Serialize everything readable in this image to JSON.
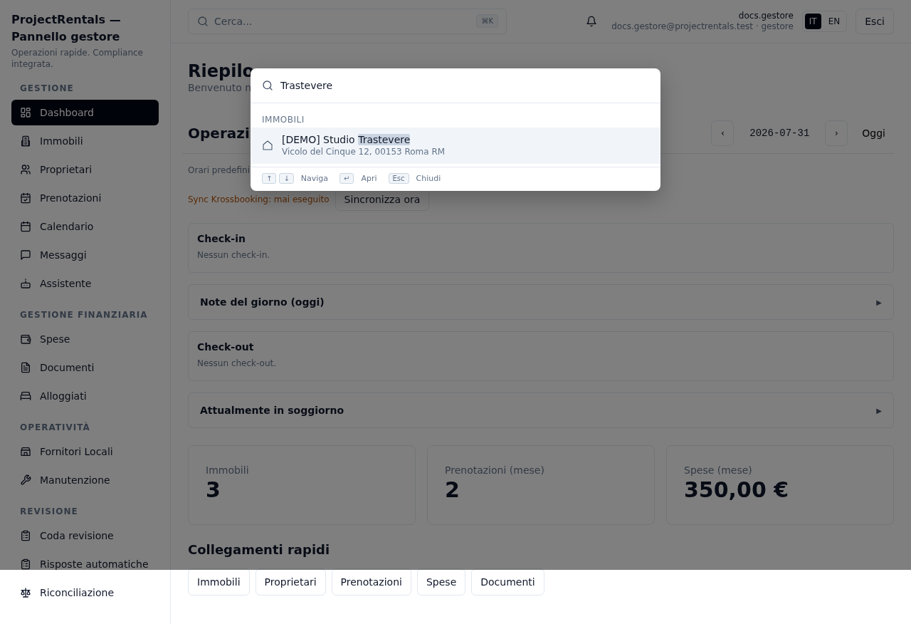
{
  "sidebar": {
    "title": "ProjectRentals — Pannello gestore",
    "subtitle": "Operazioni rapide. Compliance integrata.",
    "sections": [
      {
        "heading": "GESTIONE",
        "items": [
          {
            "label": "Dashboard",
            "selected": true
          },
          {
            "label": "Immobili",
            "selected": false
          },
          {
            "label": "Proprietari",
            "selected": false
          },
          {
            "label": "Prenotazioni",
            "selected": false
          },
          {
            "label": "Calendario",
            "selected": false
          },
          {
            "label": "Messaggi",
            "selected": false
          },
          {
            "label": "Assistente",
            "selected": false
          }
        ]
      },
      {
        "heading": "GESTIONE FINANZIARIA",
        "items": [
          {
            "label": "Spese",
            "selected": false
          },
          {
            "label": "Documenti",
            "selected": false
          },
          {
            "label": "Alloggiati",
            "selected": false
          }
        ]
      },
      {
        "heading": "OPERATIVITÀ",
        "items": [
          {
            "label": "Fornitori Locali",
            "selected": false
          },
          {
            "label": "Manutenzione",
            "selected": false
          }
        ]
      },
      {
        "heading": "REVISIONE",
        "items": [
          {
            "label": "Coda revisione",
            "selected": false
          },
          {
            "label": "Risposte automatiche",
            "selected": false
          },
          {
            "label": "Riconciliazione",
            "selected": false
          }
        ]
      }
    ]
  },
  "header": {
    "search": {
      "placeholder": "Cerca...",
      "shortcut": "⌘K"
    },
    "user": {
      "name": "docs.gestore",
      "detail": "docs.gestore@projectrentals.test · gestore"
    },
    "languages": [
      {
        "label": "IT",
        "selected": true
      },
      {
        "label": "EN",
        "selected": false
      }
    ],
    "logout": "Esci"
  },
  "page": {
    "title": "Riepilo",
    "subtitle": "Benvenuto n",
    "operations": {
      "title": "Operazi",
      "prev": "‹",
      "date": "2026-07-31",
      "next": "›",
      "today": "Oggi",
      "hours_note": "Orari predefini",
      "sync_status": "Sync Krossbooking: mai eseguito",
      "sync_button": "Sincronizza ora"
    },
    "cards": [
      {
        "kind": "list",
        "title": "Check-in",
        "empty": "Nessun check-in."
      },
      {
        "kind": "collapsible",
        "title": "Note del giorno (oggi)",
        "marker": "▶",
        "expanded": false
      },
      {
        "kind": "list",
        "title": "Check-out",
        "empty": "Nessun check-out."
      },
      {
        "kind": "collapsible",
        "title": "Attualmente in soggiorno",
        "marker": "▶",
        "expanded": false
      }
    ],
    "stats": [
      {
        "label": "Immobili",
        "value": "3"
      },
      {
        "label": "Prenotazioni (mese)",
        "value": "2"
      },
      {
        "label": "Spese (mese)",
        "value": "350,00 €"
      }
    ],
    "quick_links": {
      "title": "Collegamenti rapidi",
      "links": [
        "Immobili",
        "Proprietari",
        "Prenotazioni",
        "Spese",
        "Documenti"
      ]
    }
  },
  "command_palette": {
    "query": "Trastevere",
    "group": "IMMOBILI",
    "results": [
      {
        "title": "[DEMO] Studio ",
        "match": "Trastevere",
        "address": "Vicolo del Cinque 12, 00153 Roma RM",
        "selected": true
      }
    ],
    "hints": [
      {
        "keys": [
          "↑",
          "↓"
        ],
        "label": "Naviga"
      },
      {
        "keys": [
          "↵"
        ],
        "label": "Apri"
      },
      {
        "keys": [
          "Esc"
        ],
        "label": "Chiudi"
      }
    ]
  }
}
